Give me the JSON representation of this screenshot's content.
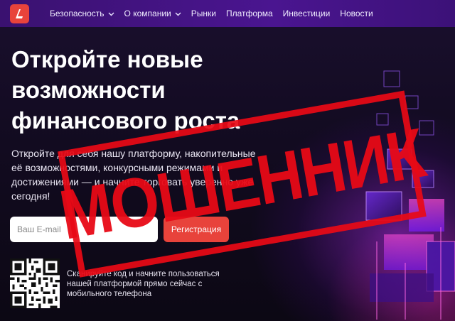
{
  "header": {
    "logo_glyph": "L",
    "nav": [
      {
        "label": "Безопасность",
        "has_dropdown": true
      },
      {
        "label": "О компании",
        "has_dropdown": true
      },
      {
        "label": "Рынки",
        "has_dropdown": false
      },
      {
        "label": "Платформа",
        "has_dropdown": false
      },
      {
        "label": "Инвестиции",
        "has_dropdown": false
      },
      {
        "label": "Новости",
        "has_dropdown": false
      }
    ],
    "chevron_glyph": "⌄"
  },
  "hero": {
    "title_lines": [
      "Откройте новые",
      "возможности",
      "финансового роста"
    ],
    "description": "Откройте для себя нашу платформу, накопительные её возможностями, конкурсными режимами и достижениями — и начните торговать уверенно уже сегодня!"
  },
  "signup": {
    "email_placeholder": "Ваш E-mail",
    "email_value": "",
    "register_label": "Регистрация"
  },
  "qr": {
    "icon": "qr-code-icon",
    "caption": "Сканируйте код и начните пользоваться нашей платформой прямо сейчас с мобильного телефона"
  },
  "stamp": {
    "text": "МОШЕННИК"
  },
  "colors": {
    "header_bg": "#3a1170",
    "accent_red": "#e8433b",
    "stamp_red": "#e80a16",
    "page_bg": "#120c1e"
  }
}
